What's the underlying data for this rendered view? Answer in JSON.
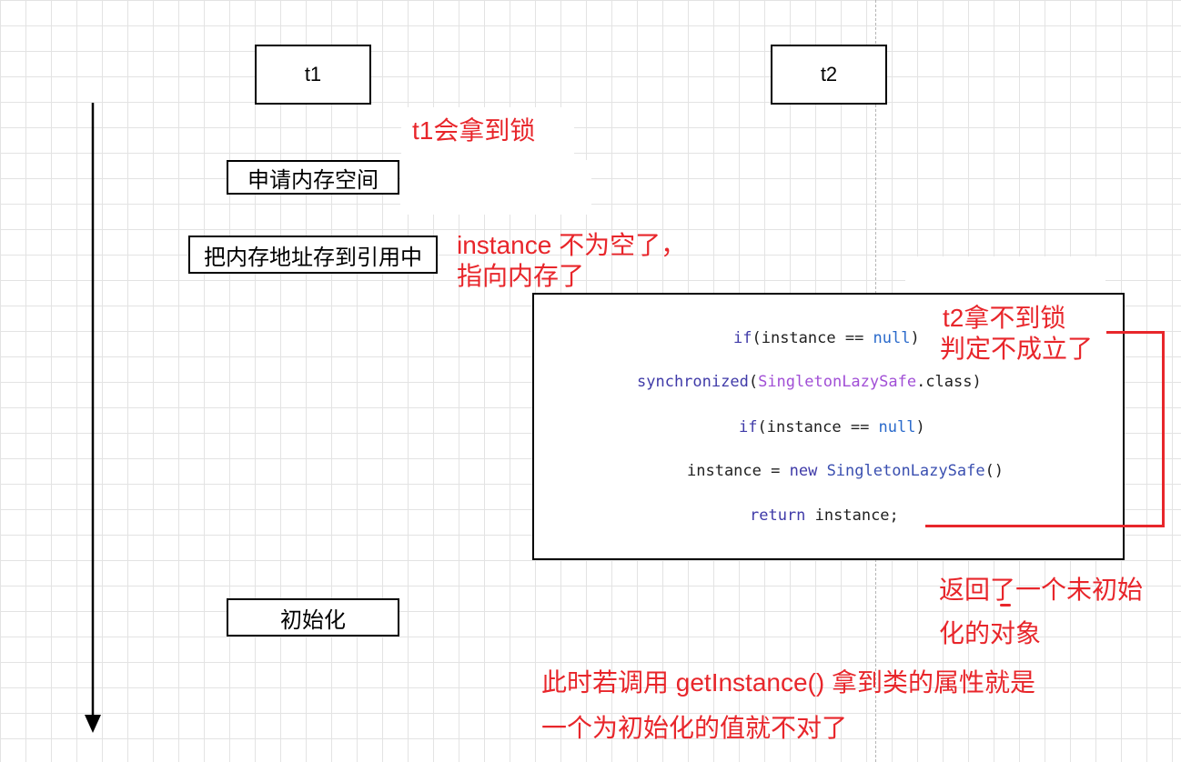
{
  "threads": {
    "t1": "t1",
    "t2": "t2"
  },
  "steps": {
    "allocate": "申请内存空间",
    "assign_ref": "把内存地址存到引用中",
    "init": "初始化"
  },
  "annotations": {
    "t1_lock": "t1会拿到锁",
    "instance_not_null_1": "instance 不为空了，",
    "instance_not_null_2": "指向内存了",
    "t2_no_lock_1": "t2拿不到锁",
    "t2_no_lock_2": "判定不成立了",
    "returned_1": "返回了一个未初始",
    "returned_2": "化的对象",
    "conclusion_1": "此时若调用  getInstance() 拿到类的属性就是",
    "conclusion_2": "一个为初始化的值就不对了"
  },
  "code": {
    "line1": {
      "kw": "if",
      "a": "(instance == ",
      "null": "null",
      "b": ")"
    },
    "line2": {
      "kw": "synchronized",
      "a": "(",
      "cls": "SingletonLazySafe",
      "b": ".class)"
    },
    "line3": {
      "kw": "if",
      "a": "(instance == ",
      "null": "null",
      "b": ")"
    },
    "line4": {
      "a": "instance = ",
      "kw": "new",
      "sp": " ",
      "cls": "SingletonLazySafe",
      "b": "()"
    },
    "line5": {
      "kw": "return",
      "a": " instance;"
    }
  },
  "colors": {
    "annotation": "#e8262b",
    "keyword": "#3f3aa8",
    "class": "#a14fd6",
    "null": "#2a6acb"
  }
}
